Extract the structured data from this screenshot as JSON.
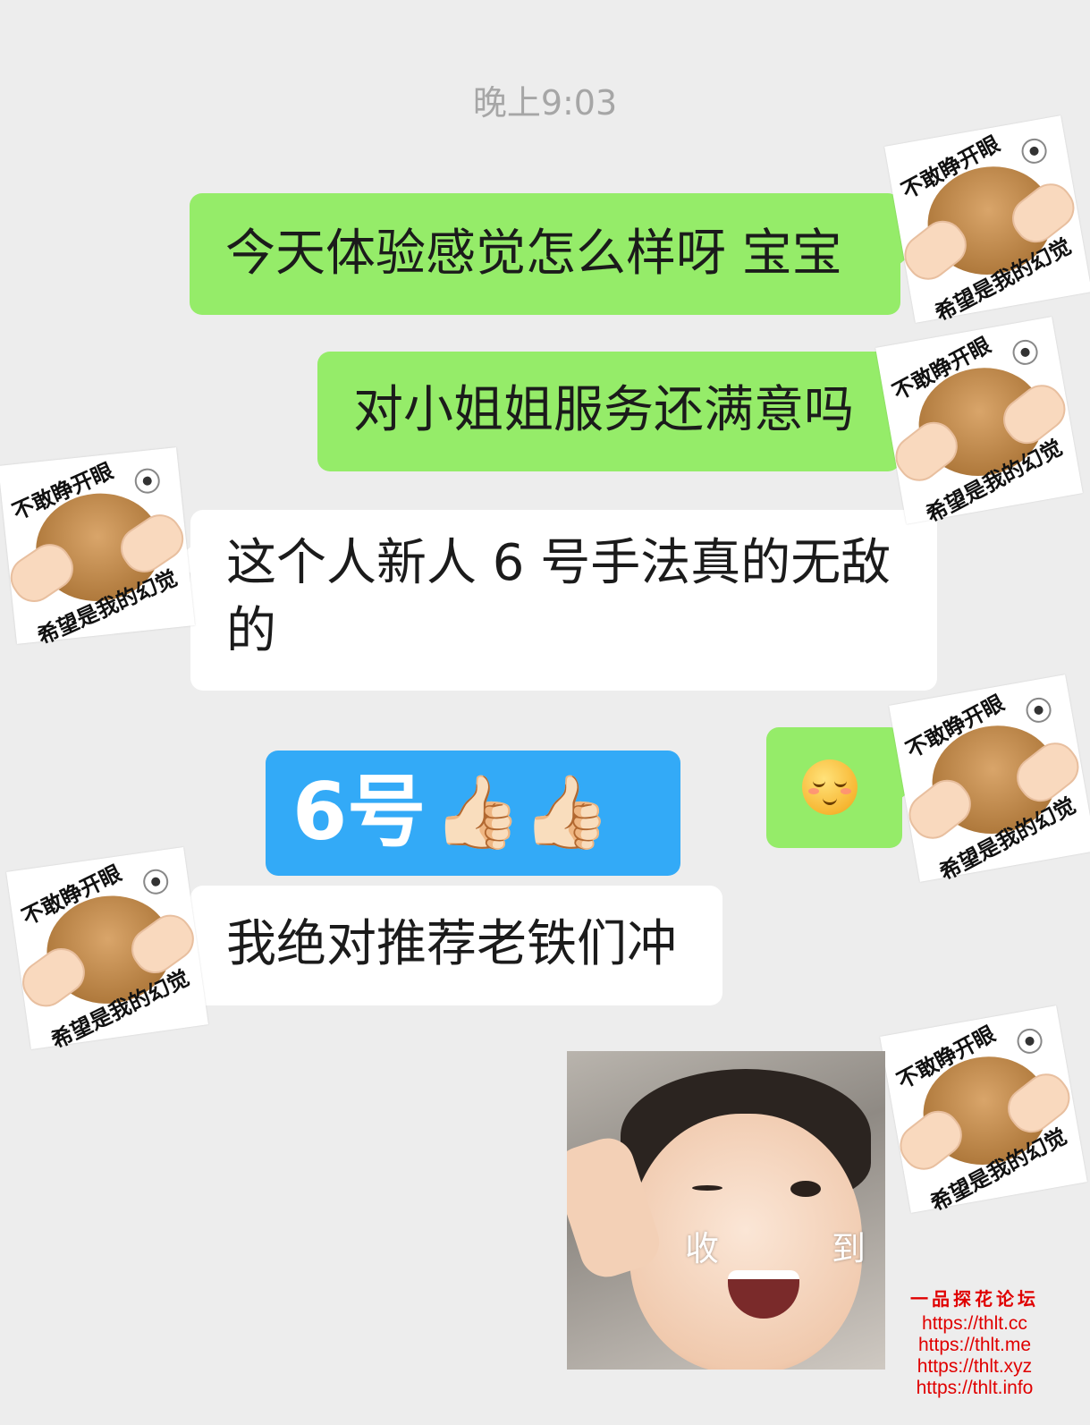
{
  "chat": {
    "timestamp": "晚上9:03",
    "messages": [
      {
        "id": "m1",
        "side": "out",
        "text": "今天体验感觉怎么样呀  宝宝"
      },
      {
        "id": "m2",
        "side": "out",
        "text": "对小姐姐服务还满意吗"
      },
      {
        "id": "m3",
        "side": "in",
        "text": "这个人新人 6 号手法真的无敌的"
      },
      {
        "id": "m4",
        "side": "out",
        "emoji": "shy-smile-emoji"
      },
      {
        "id": "m5",
        "side": "in",
        "text": "我绝对推荐老铁们冲"
      }
    ]
  },
  "overlay": {
    "banner_text": "6号",
    "banner_emojis": "👍🏻👍🏻",
    "banner_color": "#33aaf7"
  },
  "stickers": {
    "top_caption": "不敢睁开眼",
    "bottom_caption": "希望是我的幻觉"
  },
  "photo": {
    "label_left": "收",
    "label_right": "到"
  },
  "watermark": {
    "title": "一品探花论坛",
    "urls": [
      "https://thlt.cc",
      "https://thlt.me",
      "https://thlt.xyz",
      "https://thlt.info"
    ]
  },
  "colors": {
    "background": "#ededed",
    "outgoing_bubble": "#95ec69",
    "incoming_bubble": "#ffffff",
    "watermark": "#e00000"
  }
}
